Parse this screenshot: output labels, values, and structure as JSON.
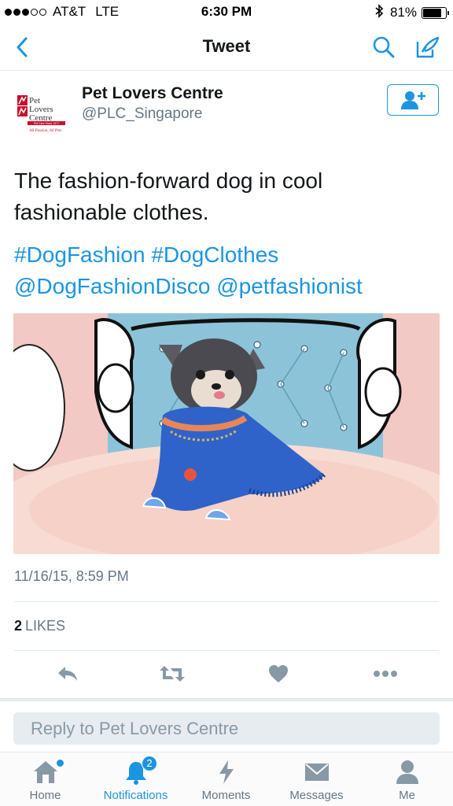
{
  "status_bar": {
    "carrier": "AT&T",
    "network": "LTE",
    "time": "6:30 PM",
    "battery": "81%",
    "battery_level": 0.81
  },
  "nav": {
    "title": "Tweet",
    "back_icon": "chevron-left-icon",
    "search_icon": "search-icon",
    "compose_icon": "compose-icon"
  },
  "author": {
    "name": "Pet Lovers Centre",
    "handle": "@PLC_Singapore",
    "follow_icon": "add-user-icon"
  },
  "tweet": {
    "text": "The fashion-forward dog in cool fashionable clothes.",
    "hashtags": [
      "#DogFashion",
      "#DogClothes"
    ],
    "mentions": [
      "@DogFashionDisco",
      "@petfashionist"
    ],
    "timestamp": "11/16/15, 8:59 PM",
    "likes_count": "2",
    "likes_label": "LIKES"
  },
  "logo": {
    "line1": "Pet",
    "line2": "Lovers",
    "line3": "Centre",
    "line4": "Pet Care Since 1977",
    "tagline": "All Passion, All Pets"
  },
  "actions": [
    "reply-icon",
    "retweet-icon",
    "like-icon",
    "more-icon"
  ],
  "reply": {
    "placeholder": "Reply to Pet Lovers Centre"
  },
  "tabs": [
    {
      "label": "Home",
      "icon": "home-icon"
    },
    {
      "label": "Notifications",
      "icon": "bell-icon",
      "badge": "2"
    },
    {
      "label": "Moments",
      "icon": "lightning-icon"
    },
    {
      "label": "Messages",
      "icon": "envelope-icon"
    },
    {
      "label": "Me",
      "icon": "person-icon"
    }
  ],
  "colors": {
    "accent": "#1b95e0",
    "text": "#14171a",
    "secondary": "#657786",
    "logo_red": "#c8102e"
  }
}
